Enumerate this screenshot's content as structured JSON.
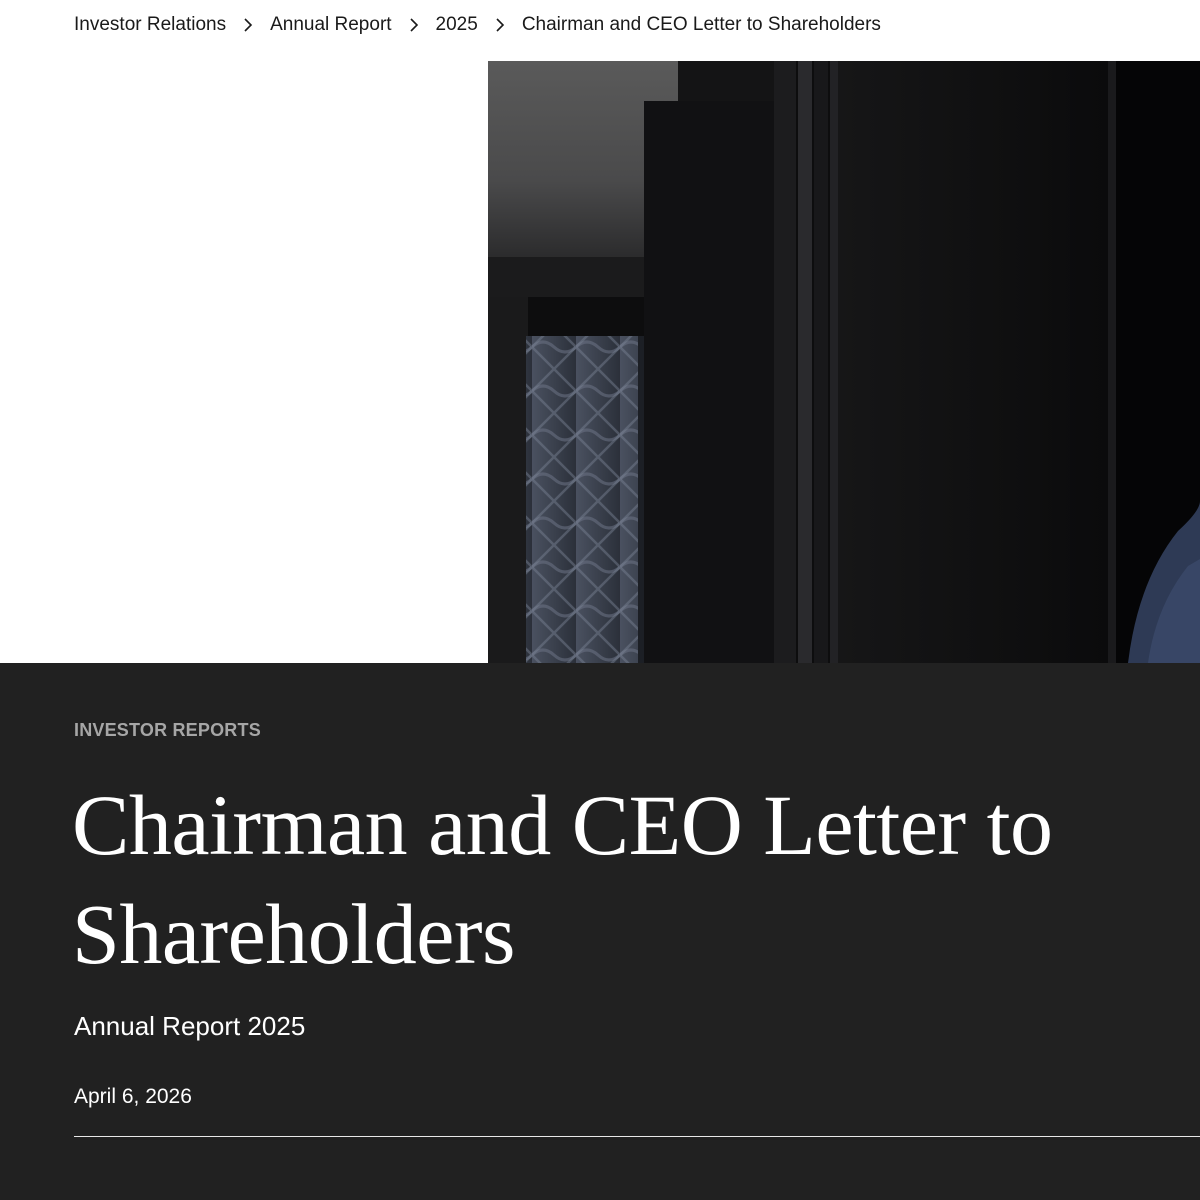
{
  "breadcrumb": {
    "items": [
      {
        "label": "Investor Relations"
      },
      {
        "label": "Annual Report"
      },
      {
        "label": "2025"
      }
    ],
    "current": "Chairman and CEO Letter to Shareholders",
    "separator_icon": "chevron-right-icon"
  },
  "hero": {
    "description_icon": "hero-photo"
  },
  "article": {
    "eyebrow": "INVESTOR REPORTS",
    "title": "Chairman and CEO Letter to Shareholders",
    "subtitle": "Annual Report 2025",
    "date": "April 6, 2026"
  },
  "colors": {
    "panel_background": "#212121",
    "eyebrow": "#a6a6a6",
    "text_light": "#ffffff",
    "text_dark": "#1a1a1a"
  }
}
